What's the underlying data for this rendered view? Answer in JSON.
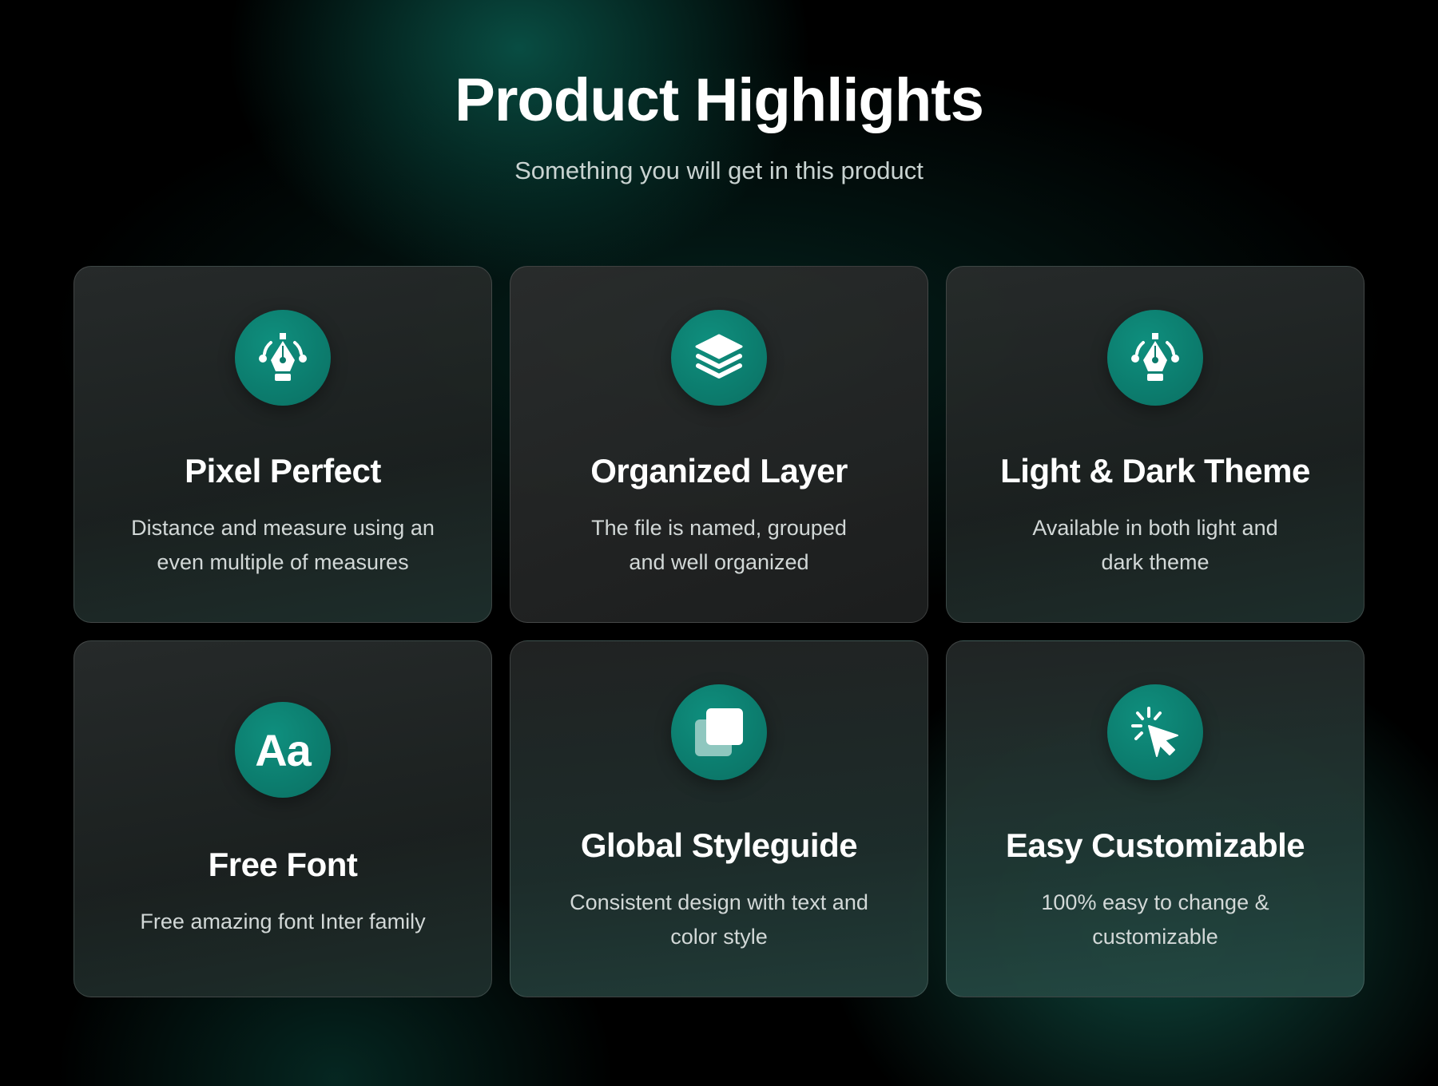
{
  "header": {
    "title": "Product Highlights",
    "subtitle": "Something you will get in this product"
  },
  "features": [
    {
      "icon": "pen-tool-icon",
      "title": "Pixel Perfect",
      "desc_line1": "Distance and measure using an",
      "desc_line2": "even multiple of measures"
    },
    {
      "icon": "layers-icon",
      "title": "Organized Layer",
      "desc_line1": "The file is named, grouped",
      "desc_line2": "and well organized"
    },
    {
      "icon": "pen-tool-icon",
      "title": "Light & Dark Theme",
      "desc_line1": "Available in both light and",
      "desc_line2": "dark theme"
    },
    {
      "icon": "font-icon",
      "icon_text": "Aa",
      "title": "Free Font",
      "desc_line1": "Free amazing font Inter family",
      "desc_line2": ""
    },
    {
      "icon": "copy-squares-icon",
      "title": "Global Styleguide",
      "desc_line1": "Consistent design with text and",
      "desc_line2": "color style"
    },
    {
      "icon": "cursor-click-icon",
      "title": "Easy Customizable",
      "desc_line1": "100% easy to change &",
      "desc_line2": "customizable"
    }
  ],
  "colors": {
    "accent": "#0a7f70",
    "background": "#000000",
    "card": "#242626"
  }
}
